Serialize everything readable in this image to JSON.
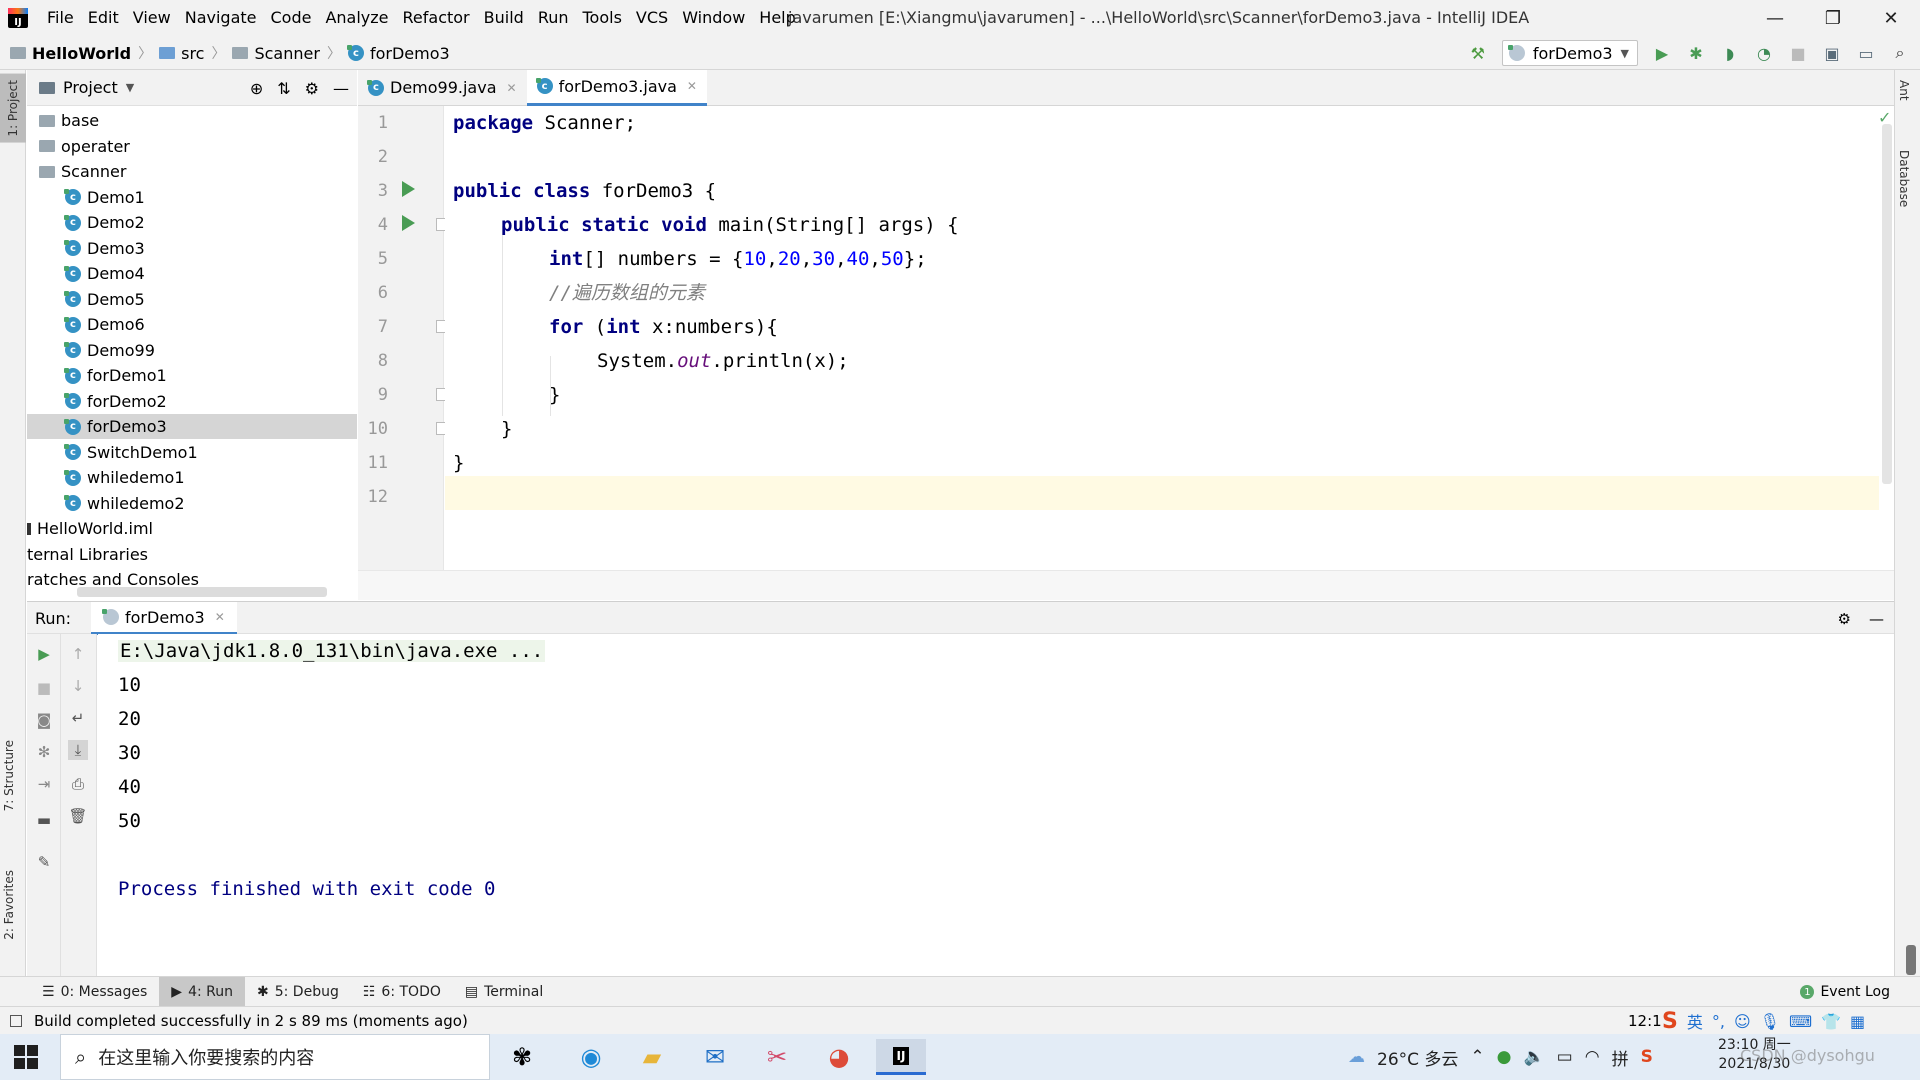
{
  "title_bar": {
    "menu": [
      "File",
      "Edit",
      "View",
      "Navigate",
      "Code",
      "Analyze",
      "Refactor",
      "Build",
      "Run",
      "Tools",
      "VCS",
      "Window",
      "Help"
    ],
    "window_title": "javarumen [E:\\Xiangmu\\javarumen] - ...\\HelloWorld\\src\\Scanner\\forDemo3.java - IntelliJ IDEA",
    "controls": [
      "—",
      "❐",
      "✕"
    ]
  },
  "navbar": {
    "breadcrumb": [
      "HelloWorld",
      "src",
      "Scanner",
      "forDemo3"
    ],
    "run_config": "forDemo3"
  },
  "left_strip": {
    "project_tab": "1: Project",
    "structure_tab": "7: Structure",
    "favorites_tab": "2: Favorites"
  },
  "right_strip": {
    "ant_tab": "Ant",
    "database_tab": "Database"
  },
  "project_panel": {
    "title": "Project",
    "tree": [
      {
        "label": "base",
        "kind": "folder"
      },
      {
        "label": "operater",
        "kind": "folder"
      },
      {
        "label": "Scanner",
        "kind": "folder"
      },
      {
        "label": "Demo1",
        "kind": "class"
      },
      {
        "label": "Demo2",
        "kind": "class"
      },
      {
        "label": "Demo3",
        "kind": "class"
      },
      {
        "label": "Demo4",
        "kind": "class"
      },
      {
        "label": "Demo5",
        "kind": "class"
      },
      {
        "label": "Demo6",
        "kind": "class"
      },
      {
        "label": "Demo99",
        "kind": "class"
      },
      {
        "label": "forDemo1",
        "kind": "class"
      },
      {
        "label": "forDemo2",
        "kind": "class"
      },
      {
        "label": "forDemo3",
        "kind": "class",
        "selected": true
      },
      {
        "label": "SwitchDemo1",
        "kind": "class"
      },
      {
        "label": "whiledemo1",
        "kind": "class"
      },
      {
        "label": "whiledemo2",
        "kind": "class"
      },
      {
        "label": "HelloWorld.iml",
        "kind": "file"
      },
      {
        "label": "ternal Libraries",
        "kind": "text"
      },
      {
        "label": "ratches and Consoles",
        "kind": "text"
      }
    ]
  },
  "editor": {
    "tabs": [
      {
        "label": "Demo99.java",
        "active": false
      },
      {
        "label": "forDemo3.java",
        "active": true
      }
    ],
    "line_numbers": [
      "1",
      "2",
      "3",
      "4",
      "5",
      "6",
      "7",
      "8",
      "9",
      "10",
      "11",
      "12"
    ],
    "code": {
      "l1_kw": "package",
      "l1_rest": " Scanner;",
      "l3_kw": "public class",
      "l3_rest": " forDemo3 {",
      "l4_kw": "public static void",
      "l4_rest": " main(String[] args) {",
      "l5_kw": "int",
      "l5_a": "[] numbers = {",
      "n1": "10",
      "n2": "20",
      "n3": "30",
      "n4": "40",
      "n5": "50",
      "l5_end": "};",
      "l6_comment": "//遍历数组的元素",
      "l7_kw1": "for",
      "l7_a": " (",
      "l7_kw2": "int",
      "l7_b": " x:numbers){",
      "l8_a": "System.",
      "l8_field": "out",
      "l8_b": ".println(x);",
      "l9": "}",
      "l10": "}",
      "l11": "}"
    }
  },
  "run_panel": {
    "label": "Run:",
    "tab": "forDemo3",
    "console": {
      "command": "E:\\Java\\jdk1.8.0_131\\bin\\java.exe ...",
      "outputs": [
        "10",
        "20",
        "30",
        "40",
        "50"
      ],
      "finish": "Process finished with exit code 0"
    }
  },
  "bottom_tabs": [
    {
      "label": "0: Messages",
      "active": false
    },
    {
      "label": "4: Run",
      "active": true
    },
    {
      "label": "5: Debug",
      "active": false
    },
    {
      "label": "6: TODO",
      "active": false
    },
    {
      "label": "Terminal",
      "active": false
    }
  ],
  "event_log": {
    "badge": "1",
    "label": "Event Log"
  },
  "status_bar": {
    "message": "Build completed successfully in 2 s 89 ms (moments ago)",
    "cursor": "12:1",
    "ime": "英"
  },
  "taskbar": {
    "search_placeholder": "在这里输入你要搜索的内容",
    "weather": "26°C 多云",
    "time": "23:10 周一",
    "date": "2021/8/30",
    "watermark": "CSDN @dysohgu"
  },
  "colors": {
    "keyword": "#000080",
    "number": "#0000ff",
    "comment": "#808080",
    "field": "#660e7a",
    "run_green": "#499c54",
    "accent_blue": "#4083c9"
  }
}
